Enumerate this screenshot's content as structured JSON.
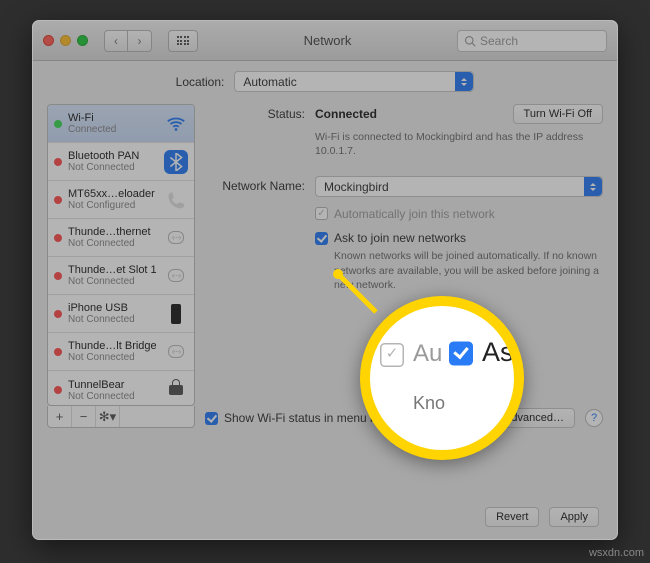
{
  "title": "Network",
  "search_placeholder": "Search",
  "location_label": "Location:",
  "location_value": "Automatic",
  "sidebar": {
    "items": [
      {
        "name": "Wi-Fi",
        "status": "Connected",
        "dot": "green",
        "icon": "wifi"
      },
      {
        "name": "Bluetooth PAN",
        "status": "Not Connected",
        "dot": "red",
        "icon": "bt"
      },
      {
        "name": "MT65xx…eloader",
        "status": "Not Configured",
        "dot": "red",
        "icon": "phone"
      },
      {
        "name": "Thunde…thernet",
        "status": "Not Connected",
        "dot": "red",
        "icon": "eth"
      },
      {
        "name": "Thunde…et Slot 1",
        "status": "Not Connected",
        "dot": "red",
        "icon": "eth"
      },
      {
        "name": "iPhone USB",
        "status": "Not Connected",
        "dot": "red",
        "icon": "usb"
      },
      {
        "name": "Thunde…lt Bridge",
        "status": "Not Connected",
        "dot": "red",
        "icon": "eth"
      },
      {
        "name": "TunnelBear",
        "status": "Not Connected",
        "dot": "red",
        "icon": "tunnel"
      }
    ]
  },
  "status_label": "Status:",
  "status_value": "Connected",
  "wifi_off_btn": "Turn Wi-Fi Off",
  "status_desc": "Wi-Fi is connected to Mockingbird and has the IP address 10.0.1.7.",
  "netname_label": "Network Name:",
  "netname_value": "Mockingbird",
  "auto_join": "Automatically join this network",
  "ask_join": "Ask to join new networks",
  "ask_desc": "Known networks will be joined automatically. If no known networks are available, you will be asked before joining a new network.",
  "show_status": "Show Wi-Fi status in menu bar",
  "advanced_btn": "Advanced…",
  "revert_btn": "Revert",
  "apply_btn": "Apply",
  "callout": {
    "auto": "Au",
    "ask": "Ask",
    "known": "Kno"
  },
  "watermark": "wsxdn.com"
}
